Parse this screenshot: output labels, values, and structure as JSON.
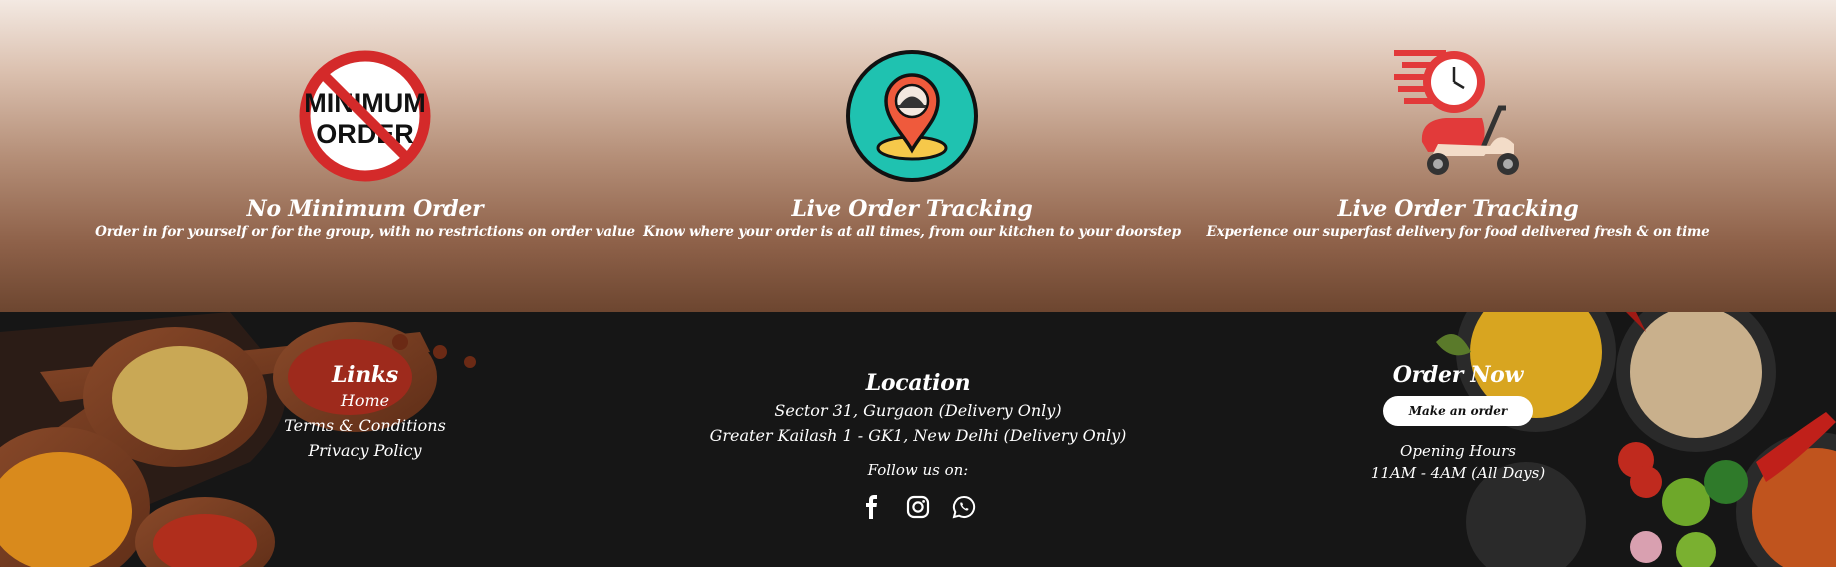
{
  "features": [
    {
      "icon": "no-minimum-order-icon",
      "icon_text_1": "MINIMUM",
      "icon_text_2": "ORDER",
      "title": "No Minimum Order",
      "desc": "Order in for yourself or for the group, with no restrictions on order value"
    },
    {
      "icon": "location-pin-icon",
      "title": "Live Order Tracking",
      "desc": "Know where your order is at all times, from our kitchen to your doorstep"
    },
    {
      "icon": "delivery-scooter-icon",
      "title": "Live Order Tracking",
      "desc": "Experience our superfast delivery for food delivered fresh & on time"
    }
  ],
  "footer": {
    "links": {
      "heading": "Links",
      "items": [
        "Home",
        "Terms & Conditions",
        "Privacy Policy"
      ]
    },
    "location": {
      "heading": "Location",
      "lines": [
        "Sector 31, Gurgaon (Delivery Only)",
        "Greater Kailash 1 - GK1, New Delhi (Delivery Only)"
      ],
      "follow_label": "Follow us on:",
      "social_icons": [
        "facebook-icon",
        "instagram-icon",
        "whatsapp-icon"
      ]
    },
    "order": {
      "heading": "Order Now",
      "button_label": "Make an order",
      "hours_label": "Opening Hours",
      "hours": "11AM - 4AM (All Days)"
    }
  },
  "colors": {
    "footer_bg": "#161616",
    "accent_red": "#d42a2a",
    "teal": "#1fc2b0",
    "white": "#ffffff"
  }
}
